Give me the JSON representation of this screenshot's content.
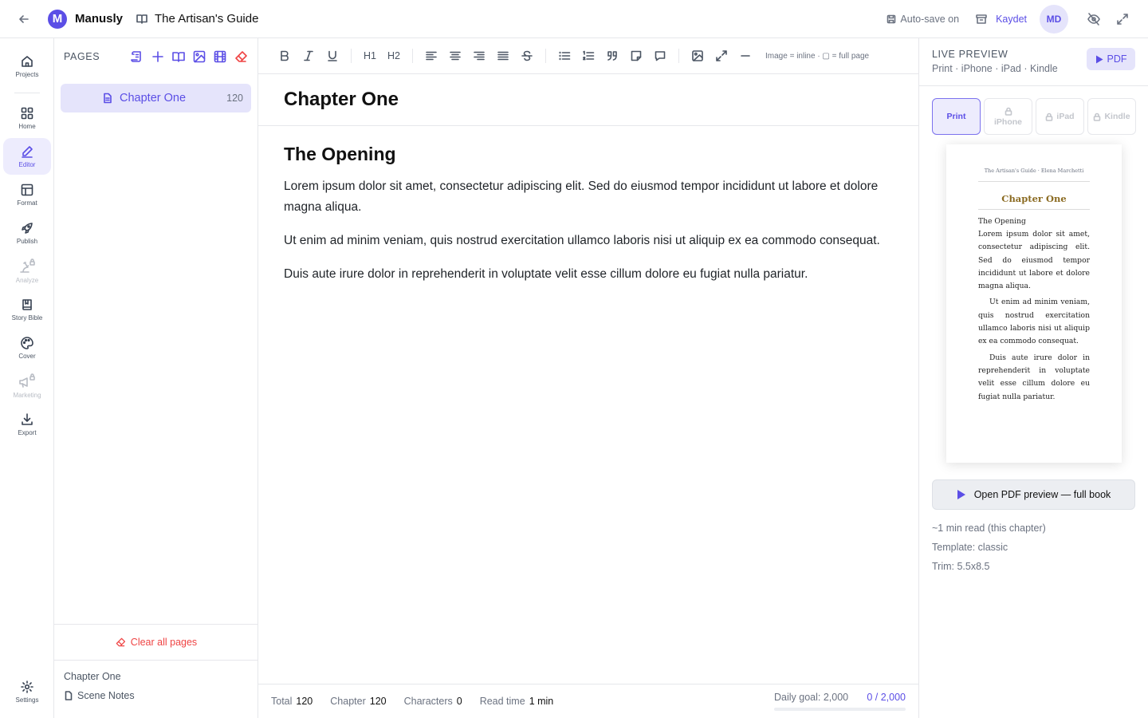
{
  "app": {
    "name": "Manusly",
    "logo_letter": "M",
    "book_title": "The Artisan's Guide"
  },
  "topbar": {
    "autosave_label": "Auto-save on",
    "save_label": "Kaydet",
    "user_initials": "MD"
  },
  "rail": {
    "items": [
      {
        "label": "Projects",
        "icon": "home-icon"
      },
      {
        "label": "Home",
        "icon": "grid-icon"
      },
      {
        "label": "Editor",
        "icon": "pen-icon",
        "active": true
      },
      {
        "label": "Format",
        "icon": "layout-icon"
      },
      {
        "label": "Publish",
        "icon": "rocket-icon"
      },
      {
        "label": "Analyze",
        "icon": "microscope-icon",
        "locked": true
      },
      {
        "label": "Story Bible",
        "icon": "book-icon"
      },
      {
        "label": "Cover",
        "icon": "palette-icon"
      },
      {
        "label": "Marketing",
        "icon": "megaphone-icon",
        "locked": true
      },
      {
        "label": "Export",
        "icon": "download-icon"
      }
    ],
    "settings_label": "Settings"
  },
  "pages_panel": {
    "title": "PAGES",
    "pages": [
      {
        "label": "Chapter One",
        "count": "120"
      }
    ],
    "clear_label": "Clear all pages",
    "notes_chapter": "Chapter One",
    "notes_item": "Scene Notes"
  },
  "toolbar": {
    "h1_label": "H1",
    "h2_label": "H2",
    "hint": "Image = inline · ▢ = full page"
  },
  "editor": {
    "chapter_title": "Chapter One",
    "heading": "The Opening",
    "paragraphs": [
      "Lorem ipsum dolor sit amet, consectetur adipiscing elit. Sed do eiusmod tempor incididunt ut labore et dolore magna aliqua.",
      "Ut enim ad minim veniam, quis nostrud exercitation ullamco laboris nisi ut aliquip ex ea commodo consequat.",
      "Duis aute irure dolor in reprehenderit in voluptate velit esse cillum dolore eu fugiat nulla pariatur."
    ]
  },
  "status": {
    "total_label": "Total",
    "total_value": "120",
    "chapter_label": "Chapter",
    "chapter_value": "120",
    "characters_label": "Characters",
    "characters_value": "0",
    "readtime_label": "Read time",
    "readtime_value": "1 min",
    "goal_label": "Daily goal: 2,000",
    "goal_value": "0 / 2,000",
    "goal_progress": 0
  },
  "preview": {
    "title": "LIVE PREVIEW",
    "subtitle": "Print · iPhone · iPad · Kindle",
    "pdf_label": "PDF",
    "devices": [
      {
        "label": "Print",
        "active": true,
        "locked": false
      },
      {
        "label": "iPhone",
        "active": false,
        "locked": true
      },
      {
        "label": "iPad",
        "active": false,
        "locked": true
      },
      {
        "label": "Kindle",
        "active": false,
        "locked": true
      }
    ],
    "page": {
      "running_head": "The Artisan's Guide · Elena Marchetti",
      "chapter_title": "Chapter One",
      "heading": "The Opening",
      "paragraphs": [
        "Lorem ipsum dolor sit amet, consectetur adipiscing elit. Sed do eiusmod tempor incididunt ut labore et dolore magna aliqua.",
        "Ut enim ad minim veniam, quis nostrud exercitation ullamco laboris nisi ut aliquip ex ea commodo consequat.",
        "Duis aute irure dolor in reprehenderit in voluptate velit esse cillum dolore eu fugiat nulla pariatur."
      ]
    },
    "open_pdf_label": "Open PDF preview — full book",
    "read_time": "~1 min read (this chapter)",
    "template": "Template: classic",
    "trim": "Trim: 5.5x8.5"
  },
  "colors": {
    "accent": "#5b4ee6",
    "danger": "#ef4444",
    "gold": "#8b6b22"
  }
}
